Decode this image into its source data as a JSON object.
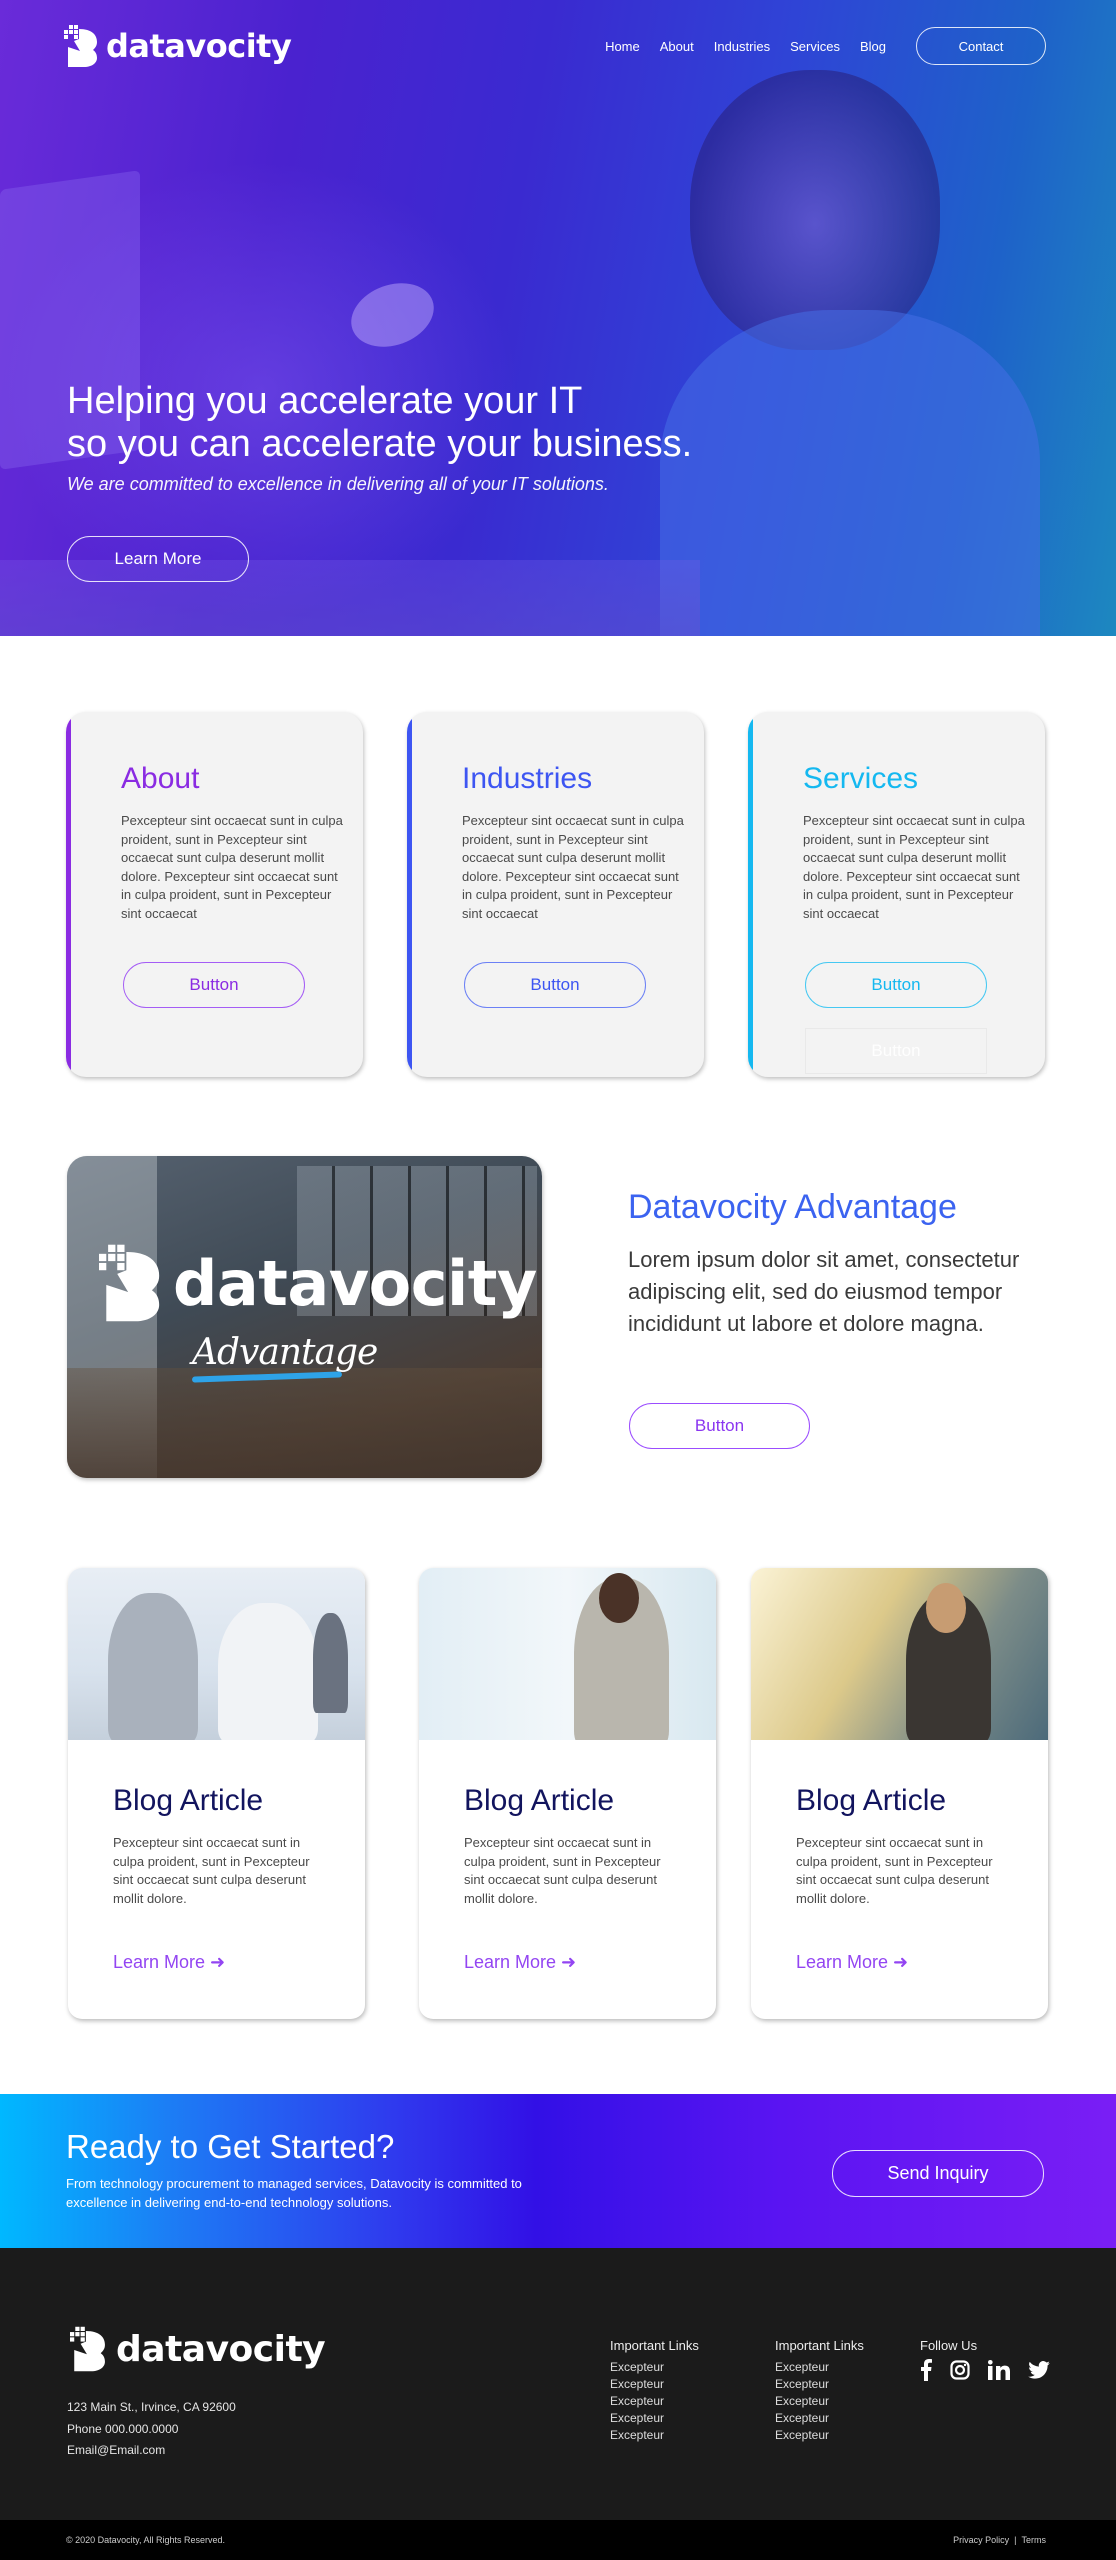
{
  "brand": {
    "name": "datavocity"
  },
  "nav": {
    "links": [
      "Home",
      "About",
      "Industries",
      "Services",
      "Blog"
    ],
    "contact_label": "Contact"
  },
  "hero": {
    "title_line1": "Helping you accelerate your IT",
    "title_line2": "so you can accelerate your business.",
    "subtitle": "We are committed to excellence in delivering all of your IT solutions.",
    "button_label": "Learn More"
  },
  "features": [
    {
      "title": "About",
      "accent": "#8a2be2",
      "body": "Pexcepteur sint occaecat sunt in culpa proident, sunt in Pexcepteur sint occaecat sunt culpa deserunt mollit dolore. Pexcepteur sint occaecat sunt in culpa proident, sunt in Pexcepteur sint occaecat",
      "button_label": "Button"
    },
    {
      "title": "Industries",
      "accent": "#3d55f2",
      "body": "Pexcepteur sint occaecat sunt in culpa proident, sunt in Pexcepteur sint occaecat sunt culpa deserunt mollit dolore. Pexcepteur sint occaecat sunt in culpa proident, sunt in Pexcepteur sint occaecat",
      "button_label": "Button"
    },
    {
      "title": "Services",
      "accent": "#14b8f0",
      "body": "Pexcepteur sint occaecat sunt in culpa proident, sunt in Pexcepteur sint occaecat sunt culpa deserunt mollit dolore. Pexcepteur sint occaecat sunt in culpa proident, sunt in Pexcepteur sint occaecat",
      "button_label": "Button",
      "ghost_button_label": "Button"
    }
  ],
  "advantage": {
    "image_brand": "datavocity",
    "image_script": "Advantage",
    "title": "Datavocity Advantage",
    "body": "Lorem ipsum dolor sit amet, consectetur adipiscing elit, sed do eiusmod tempor incididunt ut labore et dolore magna.",
    "button_label": "Button"
  },
  "blog": [
    {
      "title": "Blog Article",
      "body": "Pexcepteur sint occaecat sunt in culpa proident, sunt in Pexcepteur sint occaecat sunt culpa deserunt mollit dolore.",
      "link_label": "Learn More ➜"
    },
    {
      "title": "Blog Article",
      "body": "Pexcepteur sint occaecat sunt in culpa proident, sunt in Pexcepteur sint occaecat sunt culpa deserunt mollit dolore.",
      "link_label": "Learn More ➜"
    },
    {
      "title": "Blog Article",
      "body": "Pexcepteur sint occaecat sunt in culpa proident, sunt in Pexcepteur sint occaecat sunt culpa deserunt mollit dolore.",
      "link_label": "Learn More ➜"
    }
  ],
  "cta": {
    "title": "Ready to Get Started?",
    "body": "From technology procurement to managed services, Datavocity is committed to excellence in delivering end-to-end technology solutions.",
    "button_label": "Send Inquiry"
  },
  "footer": {
    "address": "123 Main St., Irvince, CA 92600",
    "phone": "Phone 000.000.0000",
    "email": "Email@Email.com",
    "columns": [
      {
        "heading": "Important Links",
        "links": [
          "Excepteur",
          "Excepteur",
          "Excepteur",
          "Excepteur",
          "Excepteur"
        ]
      },
      {
        "heading": "Important Links",
        "links": [
          "Excepteur",
          "Excepteur",
          "Excepteur",
          "Excepteur",
          "Excepteur"
        ]
      }
    ],
    "follow_heading": "Follow Us",
    "social": [
      "facebook-icon",
      "instagram-icon",
      "linkedin-icon",
      "twitter-icon"
    ],
    "copyright": "© 2020 Datavocity, All Rights Reserved.",
    "privacy_label": "Privacy Policy",
    "separator": "|",
    "terms_label": "Terms"
  }
}
